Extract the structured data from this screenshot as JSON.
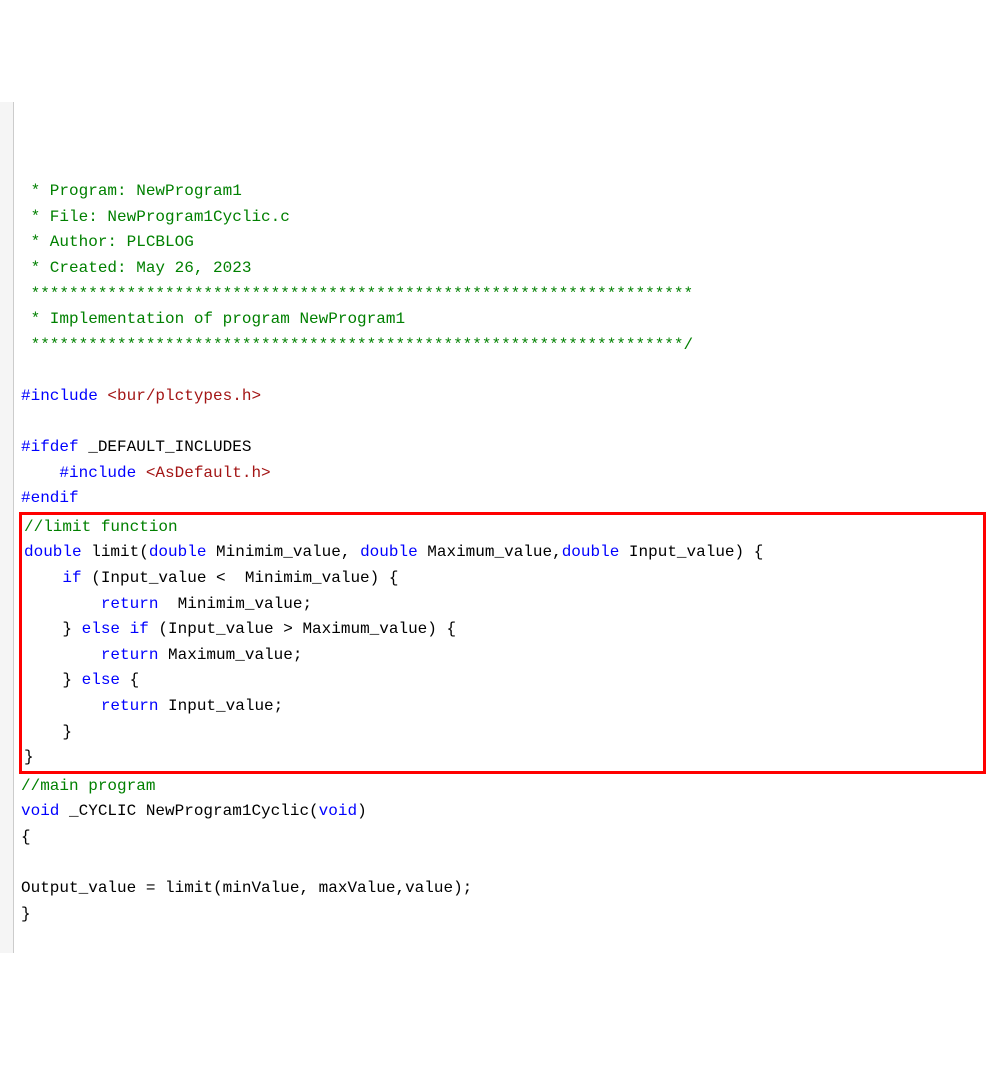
{
  "code": {
    "header": {
      "line1": " * Program: NewProgram1",
      "line2": " * File: NewProgram1Cyclic.c",
      "line3": " * Author: PLCBLOG",
      "line4": " * Created: May 26, 2023",
      "line5": " *********************************************************************",
      "line6": " * Implementation of program NewProgram1",
      "line7": " ********************************************************************/"
    },
    "include1": {
      "keyword": "#include",
      "path": " <bur/plctypes.h>"
    },
    "ifdef": {
      "keyword": "#ifdef",
      "macro": " _DEFAULT_INCLUDES"
    },
    "include2": {
      "indent": "    ",
      "keyword": "#include",
      "path": " <AsDefault.h>"
    },
    "endif": {
      "keyword": "#endif"
    },
    "limit_comment": "//limit function",
    "limit_func": {
      "type1": "double",
      "name": " limit(",
      "type2": "double",
      "param1": " Minimim_value, ",
      "type3": "double",
      "param2": " Maximum_value,",
      "type4": "double",
      "param3": " Input_value) {"
    },
    "if_line": {
      "indent": "    ",
      "keyword": "if",
      "cond": " (Input_value <  Minimim_value) {"
    },
    "return1": {
      "indent": "        ",
      "keyword": "return",
      "val": "  Minimim_value;"
    },
    "elseif": {
      "indent": "    } ",
      "keyword1": "else",
      "space": " ",
      "keyword2": "if",
      "cond": " (Input_value > Maximum_value) {"
    },
    "return2": {
      "indent": "        ",
      "keyword": "return",
      "val": " Maximum_value;"
    },
    "else_line": {
      "indent": "    } ",
      "keyword": "else",
      "rest": " {"
    },
    "return3": {
      "indent": "        ",
      "keyword": "return",
      "val": " Input_value;"
    },
    "close_inner": "    }",
    "close_func": "}",
    "main_comment": "//main program",
    "cyclic_func": {
      "type": "void",
      "name": " _CYCLIC NewProgram1Cyclic(",
      "type2": "void",
      "close": ")"
    },
    "open_brace": "{",
    "output_line": "Output_value = limit(minValue, maxValue,value);",
    "close_brace": "}"
  }
}
